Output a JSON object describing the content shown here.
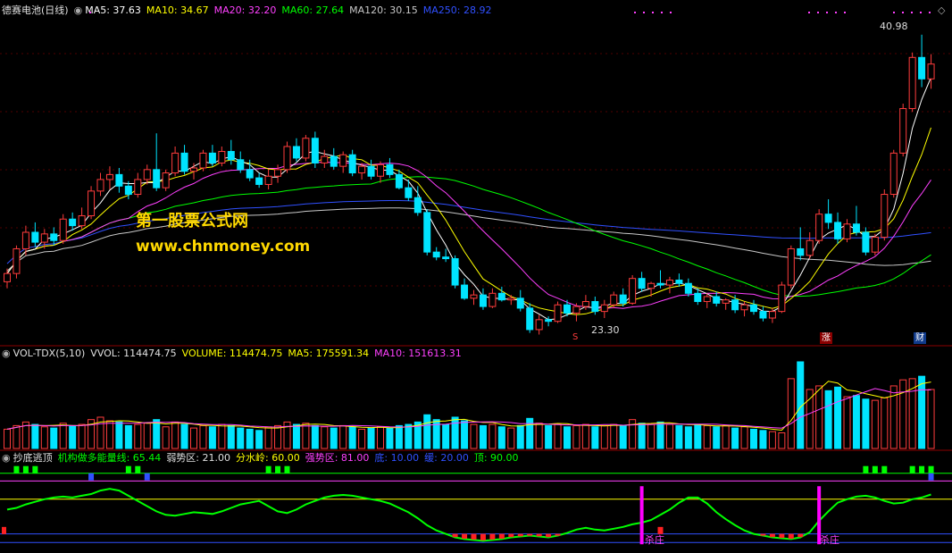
{
  "panel_main": {
    "stock": "德赛电池(日线)",
    "ma5": "MA5: 37.63",
    "ma10": "MA10: 34.67",
    "ma20": "MA20: 32.20",
    "ma60": "MA60: 27.64",
    "ma120": "MA120: 30.15",
    "ma250": "MA250: 28.92",
    "high_label": "40.98",
    "low_label": "23.30",
    "marker_s": "S",
    "marker_zhang": "涨",
    "marker_cai": "财"
  },
  "panel_vol": {
    "name": "VOL-TDX(5,10)",
    "vvol": "VVOL: 114474.75",
    "volume": "VOLUME: 114474.75",
    "ma5": "MA5: 175591.34",
    "ma10": "MA10: 151613.31"
  },
  "panel_ind": {
    "name": "抄底逃顶",
    "energy": "机构做多能量线: 65.44",
    "weak": "弱势区: 21.00",
    "divide": "分水岭: 60.00",
    "strong": "强势区: 81.00",
    "bottom": "底: 10.00",
    "slow": "缓: 20.00",
    "top": "顶: 90.00",
    "kill1": "杀庄",
    "kill2": "杀庄"
  },
  "watermark": {
    "line1": "第一股票公式网",
    "line2": "www.chnmoney.com"
  },
  "colors": {
    "up": "#ff3c3c",
    "down": "#00e4ff",
    "ma5": "#ffffff",
    "ma10": "#ffff00",
    "ma20": "#ff40ff",
    "ma60": "#00ff00",
    "ma120": "#c8c8c8",
    "ma250": "#3050ff"
  },
  "chart_data": {
    "type": "candlestick",
    "title": "德赛电池(日线)",
    "price_range": [
      22.5,
      42.0
    ],
    "candles": [
      [
        26.0,
        26.8,
        25.6,
        26.5
      ],
      [
        26.5,
        28.2,
        26.2,
        28.0
      ],
      [
        28.0,
        29.4,
        27.6,
        29.0
      ],
      [
        29.0,
        29.6,
        28.1,
        28.4
      ],
      [
        28.4,
        29.2,
        28.0,
        28.9
      ],
      [
        28.9,
        29.3,
        28.2,
        28.5
      ],
      [
        28.5,
        30.1,
        28.3,
        29.8
      ],
      [
        29.8,
        30.2,
        29.1,
        29.4
      ],
      [
        29.4,
        30.5,
        29.2,
        30.0
      ],
      [
        30.0,
        31.8,
        29.8,
        31.5
      ],
      [
        31.5,
        32.6,
        31.2,
        32.2
      ],
      [
        32.2,
        33.0,
        31.6,
        32.5
      ],
      [
        32.5,
        32.9,
        31.4,
        31.8
      ],
      [
        31.8,
        32.1,
        31.0,
        31.3
      ],
      [
        31.3,
        32.6,
        31.1,
        32.2
      ],
      [
        32.2,
        33.1,
        31.9,
        32.8
      ],
      [
        32.8,
        35.0,
        31.5,
        31.7
      ],
      [
        31.7,
        32.8,
        31.5,
        32.6
      ],
      [
        32.6,
        34.2,
        32.4,
        33.8
      ],
      [
        33.8,
        34.3,
        32.5,
        32.7
      ],
      [
        32.7,
        33.2,
        32.2,
        32.9
      ],
      [
        32.9,
        34.0,
        32.7,
        33.8
      ],
      [
        33.8,
        34.3,
        33.0,
        33.2
      ],
      [
        33.2,
        34.2,
        33.0,
        33.9
      ],
      [
        33.9,
        34.6,
        33.1,
        33.4
      ],
      [
        33.4,
        33.9,
        32.6,
        32.8
      ],
      [
        32.8,
        33.4,
        32.1,
        32.3
      ],
      [
        32.3,
        32.6,
        31.7,
        31.9
      ],
      [
        31.9,
        32.8,
        31.6,
        32.4
      ],
      [
        32.4,
        33.1,
        32.0,
        32.8
      ],
      [
        32.8,
        34.5,
        32.6,
        34.2
      ],
      [
        34.2,
        34.7,
        33.3,
        33.5
      ],
      [
        33.5,
        34.9,
        33.3,
        34.7
      ],
      [
        34.7,
        35.1,
        32.9,
        33.2
      ],
      [
        33.2,
        34.0,
        32.9,
        33.6
      ],
      [
        33.6,
        34.1,
        32.8,
        33.0
      ],
      [
        33.0,
        33.9,
        32.6,
        33.7
      ],
      [
        33.7,
        34.0,
        32.4,
        32.6
      ],
      [
        32.6,
        33.2,
        32.2,
        33.0
      ],
      [
        33.0,
        33.4,
        32.2,
        32.4
      ],
      [
        32.4,
        33.3,
        32.0,
        33.1
      ],
      [
        33.1,
        33.5,
        32.3,
        32.5
      ],
      [
        32.5,
        32.8,
        31.6,
        31.7
      ],
      [
        31.7,
        32.2,
        30.9,
        31.1
      ],
      [
        31.1,
        31.8,
        30.0,
        30.2
      ],
      [
        30.2,
        30.4,
        27.6,
        27.8
      ],
      [
        27.8,
        28.1,
        27.3,
        27.5
      ],
      [
        27.5,
        28.0,
        27.2,
        27.4
      ],
      [
        27.4,
        27.6,
        25.6,
        25.8
      ],
      [
        25.8,
        26.2,
        24.9,
        25.0
      ],
      [
        25.0,
        25.5,
        24.6,
        25.2
      ],
      [
        25.2,
        25.6,
        24.3,
        24.5
      ],
      [
        24.5,
        25.6,
        24.4,
        25.3
      ],
      [
        25.3,
        25.7,
        24.8,
        24.9
      ],
      [
        24.9,
        25.2,
        24.6,
        25.0
      ],
      [
        25.0,
        25.5,
        24.2,
        24.4
      ],
      [
        24.4,
        24.7,
        22.9,
        23.1
      ],
      [
        23.1,
        24.0,
        22.8,
        23.7
      ],
      [
        23.7,
        23.9,
        23.3,
        23.6
      ],
      [
        23.6,
        24.8,
        23.5,
        24.6
      ],
      [
        24.6,
        24.9,
        23.9,
        24.1
      ],
      [
        24.1,
        24.7,
        23.6,
        24.5
      ],
      [
        24.5,
        25.2,
        24.3,
        24.8
      ],
      [
        24.8,
        25.1,
        24.0,
        24.2
      ],
      [
        24.2,
        24.9,
        23.8,
        24.6
      ],
      [
        24.6,
        25.4,
        24.4,
        25.2
      ],
      [
        25.2,
        25.6,
        24.5,
        24.7
      ],
      [
        24.7,
        26.4,
        24.6,
        26.2
      ],
      [
        26.2,
        26.6,
        25.4,
        25.6
      ],
      [
        25.6,
        26.0,
        25.1,
        25.9
      ],
      [
        25.9,
        26.7,
        25.6,
        25.8
      ],
      [
        25.8,
        26.3,
        25.3,
        26.1
      ],
      [
        26.1,
        26.5,
        25.7,
        25.9
      ],
      [
        25.9,
        26.2,
        25.1,
        25.3
      ],
      [
        25.3,
        25.6,
        24.6,
        24.8
      ],
      [
        24.8,
        25.3,
        24.4,
        25.1
      ],
      [
        25.1,
        25.4,
        24.5,
        24.7
      ],
      [
        24.7,
        25.0,
        24.3,
        24.9
      ],
      [
        24.9,
        25.2,
        24.1,
        24.3
      ],
      [
        24.3,
        24.8,
        23.9,
        24.6
      ],
      [
        24.6,
        24.9,
        24.0,
        24.2
      ],
      [
        24.2,
        24.5,
        23.6,
        23.8
      ],
      [
        23.8,
        24.4,
        23.5,
        24.2
      ],
      [
        24.2,
        26.0,
        24.1,
        25.8
      ],
      [
        25.8,
        28.2,
        25.6,
        28.0
      ],
      [
        28.0,
        29.3,
        27.3,
        27.6
      ],
      [
        27.6,
        29.0,
        27.4,
        28.5
      ],
      [
        28.5,
        30.4,
        28.3,
        30.1
      ],
      [
        30.1,
        31.0,
        29.2,
        29.6
      ],
      [
        29.6,
        30.2,
        28.3,
        28.6
      ],
      [
        28.6,
        29.8,
        28.4,
        29.5
      ],
      [
        29.5,
        30.6,
        28.8,
        29.0
      ],
      [
        29.0,
        29.3,
        27.6,
        27.8
      ],
      [
        27.8,
        28.9,
        27.6,
        28.7
      ],
      [
        28.7,
        31.6,
        28.5,
        31.3
      ],
      [
        31.3,
        34.0,
        31.1,
        33.8
      ],
      [
        33.8,
        36.8,
        33.6,
        36.5
      ],
      [
        36.5,
        39.9,
        36.3,
        39.6
      ],
      [
        39.6,
        40.98,
        37.8,
        38.3
      ],
      [
        38.3,
        39.8,
        37.7,
        39.2
      ]
    ],
    "volume": [
      80,
      95,
      110,
      100,
      90,
      85,
      105,
      95,
      100,
      120,
      130,
      115,
      110,
      95,
      100,
      105,
      120,
      90,
      110,
      100,
      85,
      95,
      90,
      100,
      95,
      85,
      80,
      75,
      90,
      95,
      110,
      100,
      105,
      95,
      90,
      85,
      95,
      90,
      80,
      85,
      90,
      85,
      95,
      100,
      110,
      140,
      120,
      100,
      130,
      115,
      100,
      95,
      100,
      90,
      85,
      95,
      125,
      105,
      95,
      100,
      90,
      95,
      100,
      90,
      95,
      100,
      95,
      120,
      105,
      100,
      110,
      100,
      95,
      90,
      100,
      95,
      90,
      95,
      85,
      90,
      80,
      75,
      70,
      65,
      290,
      360,
      245,
      260,
      240,
      255,
      215,
      220,
      205,
      200,
      210,
      260,
      285,
      290,
      300,
      245
    ],
    "indicator_energy": [
      48,
      50,
      54,
      57,
      60,
      62,
      63,
      62,
      64,
      66,
      70,
      72,
      70,
      64,
      58,
      52,
      46,
      42,
      41,
      43,
      45,
      44,
      43,
      46,
      50,
      54,
      56,
      58,
      52,
      46,
      44,
      48,
      54,
      58,
      62,
      64,
      65,
      64,
      62,
      60,
      58,
      55,
      50,
      45,
      38,
      30,
      24,
      20,
      16,
      14,
      13,
      12,
      13,
      14,
      16,
      17,
      18,
      17,
      16,
      18,
      21,
      25,
      27,
      25,
      24,
      26,
      28,
      31,
      33,
      36,
      42,
      48,
      56,
      62,
      62,
      55,
      45,
      37,
      30,
      24,
      20,
      18,
      16,
      15,
      14,
      16,
      22,
      35,
      46,
      56,
      60,
      63,
      64,
      62,
      58,
      55,
      56,
      60,
      62,
      65.44
    ],
    "levels": {
      "weak": 21.0,
      "divide": 60.0,
      "strong": 81.0,
      "bottom": 10.0,
      "slow": 20.0,
      "top": 90.0
    }
  }
}
